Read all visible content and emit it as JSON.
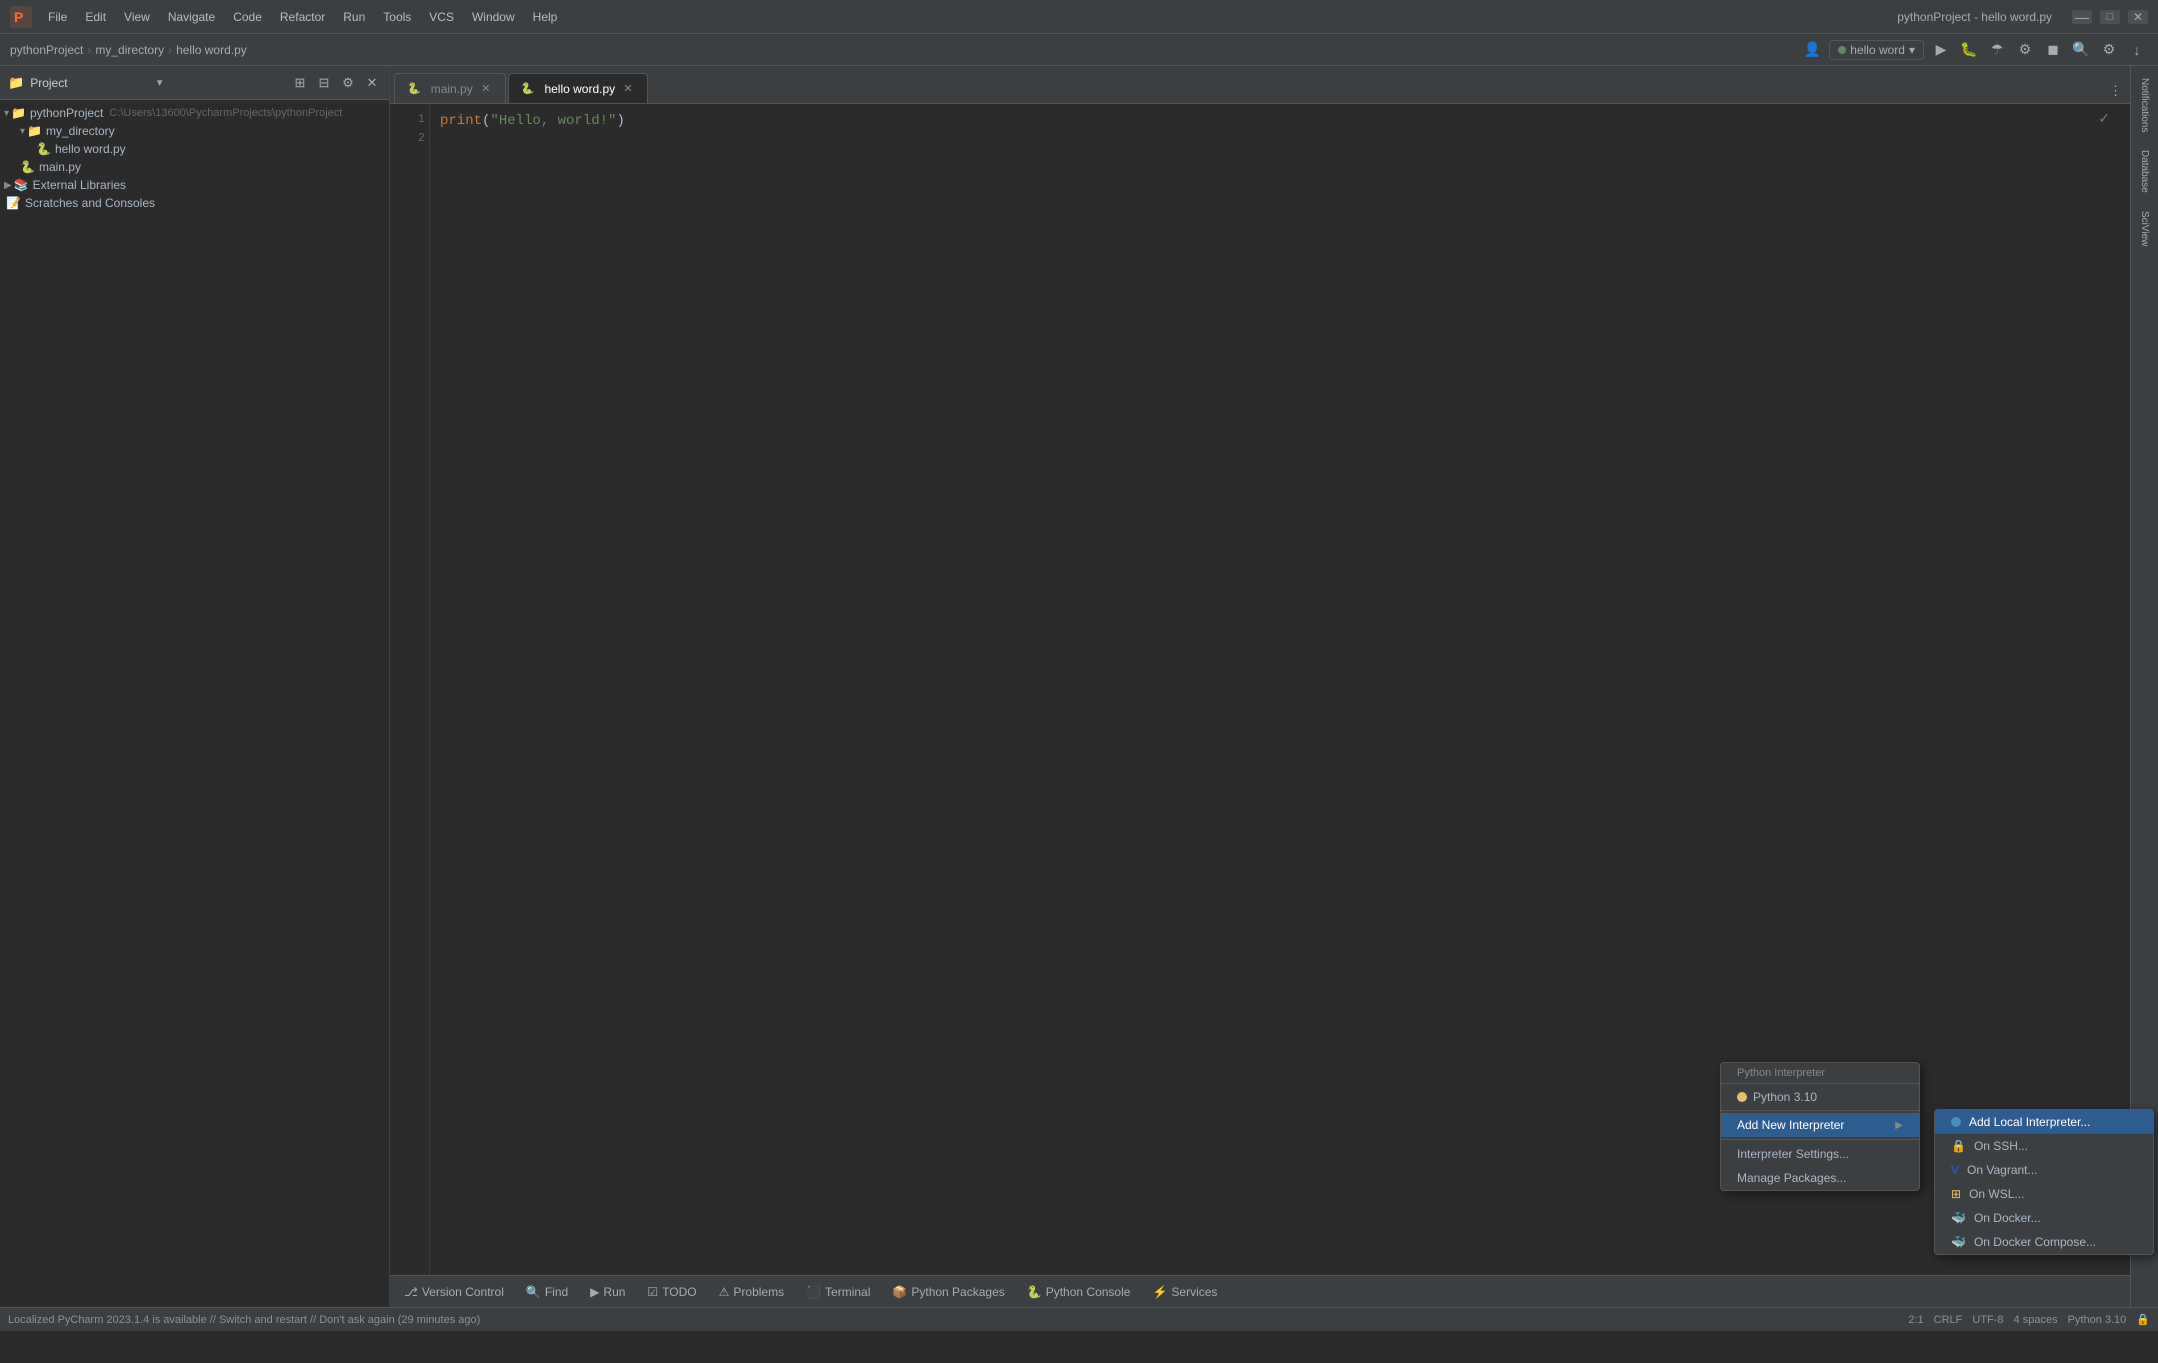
{
  "titleBar": {
    "appName": "pythonProject - hello word.py",
    "menuItems": [
      "File",
      "Edit",
      "View",
      "Navigate",
      "Code",
      "Refactor",
      "Run",
      "Tools",
      "VCS",
      "Window",
      "Help"
    ],
    "windowControls": {
      "minimize": "—",
      "maximize": "□",
      "close": "✕"
    }
  },
  "navBar": {
    "breadcrumb": [
      "pythonProject",
      "my_directory",
      "hello word.py"
    ],
    "interpreterLabel": "hello word",
    "interpreterVersion": "Python 3.10"
  },
  "projectPanel": {
    "title": "Project",
    "root": "pythonProject",
    "rootPath": "C:\\Users\\13600\\PycharmProjects\\pythonProject",
    "items": [
      {
        "label": "pythonProject",
        "type": "folder",
        "depth": 0,
        "expanded": true
      },
      {
        "label": "my_directory",
        "type": "folder",
        "depth": 1,
        "expanded": true
      },
      {
        "label": "hello word.py",
        "type": "py",
        "depth": 2
      },
      {
        "label": "main.py",
        "type": "py",
        "depth": 1
      },
      {
        "label": "External Libraries",
        "type": "extlib",
        "depth": 0,
        "expanded": false
      },
      {
        "label": "Scratches and Consoles",
        "type": "scratch",
        "depth": 0
      }
    ]
  },
  "tabs": [
    {
      "label": "main.py",
      "active": false,
      "modified": false
    },
    {
      "label": "hello word.py",
      "active": true,
      "modified": false
    }
  ],
  "editor": {
    "filename": "hello word.py",
    "lines": [
      {
        "num": 1,
        "content": "print(\"Hello, world!\")"
      },
      {
        "num": 2,
        "content": ""
      }
    ]
  },
  "bottomTabs": [
    {
      "label": "Version Control",
      "icon": "git"
    },
    {
      "label": "Find",
      "icon": "search"
    },
    {
      "label": "Run",
      "icon": "run"
    },
    {
      "label": "TODO",
      "icon": "todo"
    },
    {
      "label": "Problems",
      "icon": "warning"
    },
    {
      "label": "Terminal",
      "icon": "terminal"
    },
    {
      "label": "Python Packages",
      "icon": "package"
    },
    {
      "label": "Python Console",
      "icon": "console"
    },
    {
      "label": "Services",
      "icon": "services"
    }
  ],
  "statusBar": {
    "message": "Localized PyCharm 2023.1.4 is available // Switch and restart // Don't ask again (29 minutes ago)",
    "position": "2:1",
    "lineEnding": "CRLF",
    "encoding": "UTF-8",
    "indent": "4 spaces",
    "interpreter": "Python 3.10"
  },
  "rightSidebarItems": [
    "Notifications",
    "Database",
    "SciView"
  ],
  "interpreterMenu": {
    "title": "Python Interpreter",
    "items": [
      {
        "label": "Python 3.10",
        "type": "interpreter"
      },
      {
        "label": "Add New Interpreter",
        "type": "submenu",
        "highlighted": true
      }
    ],
    "otherItems": [
      {
        "label": "Interpreter Settings..."
      },
      {
        "label": "Manage Packages..."
      }
    ]
  },
  "addInterpreterMenu": {
    "title": "Add New Interpreter",
    "items": [
      {
        "label": "Add Local Interpreter...",
        "highlighted": true
      },
      {
        "label": "On SSH..."
      },
      {
        "label": "On Vagrant..."
      },
      {
        "label": "On WSL..."
      },
      {
        "label": "On Docker..."
      },
      {
        "label": "On Docker Compose..."
      }
    ]
  }
}
